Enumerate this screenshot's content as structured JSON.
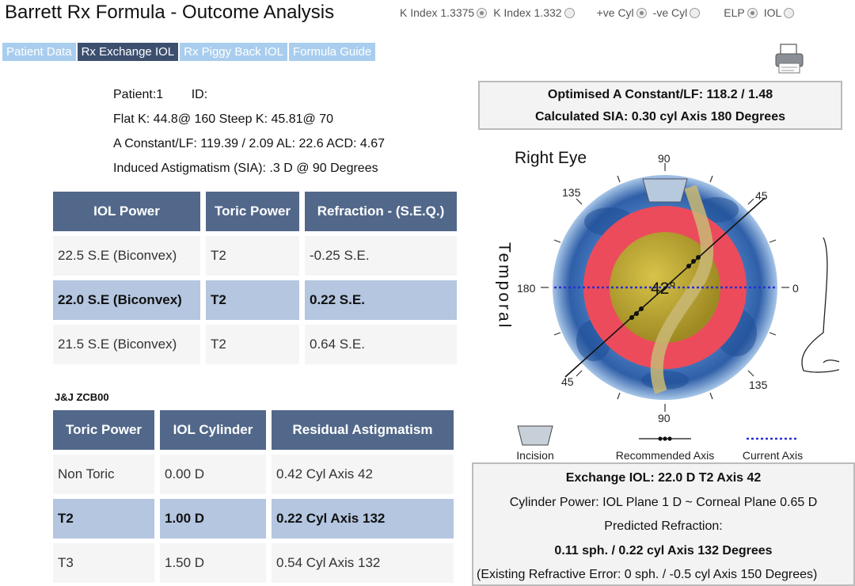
{
  "title": "Barrett Rx Formula - Outcome Analysis",
  "options": {
    "k_index_1": "K Index 1.3375",
    "k_index_2": "K Index 1.332",
    "pos_cyl": "+ve Cyl",
    "neg_cyl": "-ve Cyl",
    "elp": "ELP",
    "iol": "IOL"
  },
  "tabs": [
    "Patient Data",
    "Rx Exchange IOL",
    "Rx Piggy Back IOL",
    "Formula Guide"
  ],
  "patient": {
    "line1": "Patient:1        ID:",
    "line2": "Flat K: 44.8@ 160 Steep K: 45.81@ 70",
    "line3": "A Constant/LF: 119.39 / 2.09  AL: 22.6 ACD: 4.67",
    "line4": "Induced Astigmatism (SIA): .3 D @  90 Degrees"
  },
  "optimised": {
    "line1": "Optimised A Constant/LF: 118.2 / 1.48",
    "line2": "Calculated SIA: 0.30 cyl Axis 180 Degrees"
  },
  "table1": {
    "headers": [
      "IOL Power",
      "Toric Power",
      "Refraction - (S.E.Q.)"
    ],
    "rows": [
      [
        "22.5 S.E (Biconvex)",
        "T2",
        "-0.25 S.E."
      ],
      [
        "22.0 S.E (Biconvex)",
        "T2",
        "0.22 S.E."
      ],
      [
        "21.5 S.E (Biconvex)",
        "T2",
        "0.64 S.E."
      ]
    ]
  },
  "lens_model": "J&J ZCB00",
  "table2": {
    "headers": [
      "Toric Power",
      "IOL Cylinder",
      "Residual Astigmatism"
    ],
    "rows": [
      [
        "Non Toric",
        "0.00 D",
        "0.42 Cyl Axis 42"
      ],
      [
        "T2",
        "1.00 D",
        "0.22 Cyl Axis 132"
      ],
      [
        "T3",
        "1.50 D",
        "0.54 Cyl Axis 132"
      ]
    ]
  },
  "eye": {
    "label": "Right Eye",
    "side": "Temporal",
    "axis_value": "42°",
    "ticks": {
      "t90": "90",
      "t135": "135",
      "t45": "45",
      "t180": "180",
      "t0": "0",
      "b45": "45",
      "b135": "135",
      "b90": "90"
    }
  },
  "legend": {
    "incision": "Incision",
    "recommended": "Recommended Axis",
    "current": "Current Axis"
  },
  "exchange": {
    "line1": "Exchange IOL: 22.0 D   T2   Axis 42",
    "line2": "Cylinder Power: IOL Plane 1 D ~ Corneal Plane 0.65 D",
    "line3": "Predicted Refraction:",
    "line4": "0.11 sph. / 0.22 cyl Axis 132 Degrees",
    "line5": "(Existing Refractive Error: 0 sph. / -0.5 cyl Axis 150 Degrees)"
  },
  "colors": {
    "header": "#52688a",
    "selected_row": "#b4c6e0",
    "tab": "#a9cdee",
    "tab_active": "#3d4f6f",
    "ring_red": "#ec4b5c",
    "lens_gold": "#b9a431",
    "cornea_blue": "#3c6fb3"
  }
}
